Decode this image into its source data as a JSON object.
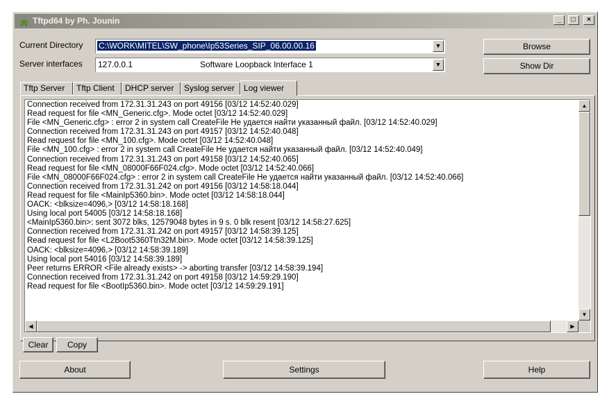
{
  "window": {
    "title": "Tftpd64 by Ph. Jounin",
    "controls": {
      "minimize": "_",
      "maximize": "□",
      "close": "×"
    }
  },
  "current_directory": {
    "label": "Current Directory",
    "value": "C:\\WORK\\MITEL\\SW_phone\\Ip53Series_SIP_06.00.00.16"
  },
  "server_interfaces": {
    "label": "Server interfaces",
    "ip": "127.0.0.1",
    "description": "Software Loopback Interface 1"
  },
  "buttons": {
    "browse": "Browse",
    "show_dir": "Show Dir",
    "clear": "Clear",
    "copy": "Copy",
    "about": "About",
    "settings": "Settings",
    "help": "Help"
  },
  "tabs": [
    "Tftp Server",
    "Tftp Client",
    "DHCP server",
    "Syslog server",
    "Log viewer"
  ],
  "active_tab": "Log viewer",
  "log": [
    "Connection received from 172.31.31.243 on port 49156 [03/12 14:52:40.029]",
    "Read request for file <MN_Generic.cfg>. Mode octet [03/12 14:52:40.029]",
    "File <MN_Generic.cfg> : error 2 in system call CreateFile Не удается найти указанный файл. [03/12 14:52:40.029]",
    "Connection received from 172.31.31.243 on port 49157 [03/12 14:52:40.048]",
    "Read request for file <MN_100.cfg>. Mode octet [03/12 14:52:40.048]",
    "File <MN_100.cfg> : error 2 in system call CreateFile Не удается найти указанный файл. [03/12 14:52:40.049]",
    "Connection received from 172.31.31.243 on port 49158 [03/12 14:52:40.065]",
    "Read request for file <MN_08000F66F024.cfg>. Mode octet [03/12 14:52:40.066]",
    "File <MN_08000F66F024.cfg> : error 2 in system call CreateFile Не удается найти указанный файл. [03/12 14:52:40.066]",
    "Connection received from 172.31.31.242 on port 49156 [03/12 14:58:18.044]",
    "Read request for file <MainIp5360.bin>. Mode octet [03/12 14:58:18.044]",
    "OACK: <blksize=4096,> [03/12 14:58:18.168]",
    "Using local port 54005 [03/12 14:58:18.168]",
    "<MainIp5360.bin>: sent 3072 blks, 12579048 bytes in 9 s. 0 blk resent [03/12 14:58:27.625]",
    "Connection received from 172.31.31.242 on port 49157 [03/12 14:58:39.125]",
    "Read request for file <L2Boot5360Ttn32M.bin>. Mode octet [03/12 14:58:39.125]",
    "OACK: <blksize=4096,> [03/12 14:58:39.189]",
    "Using local port 54016 [03/12 14:58:39.189]",
    "Peer returns ERROR <File already exists> -> aborting transfer [03/12 14:58:39.194]",
    "Connection received from 172.31.31.242 on port 49158 [03/12 14:59:29.190]",
    "Read request for file <BootIp5360.bin>. Mode octet [03/12 14:59:29.191]"
  ]
}
